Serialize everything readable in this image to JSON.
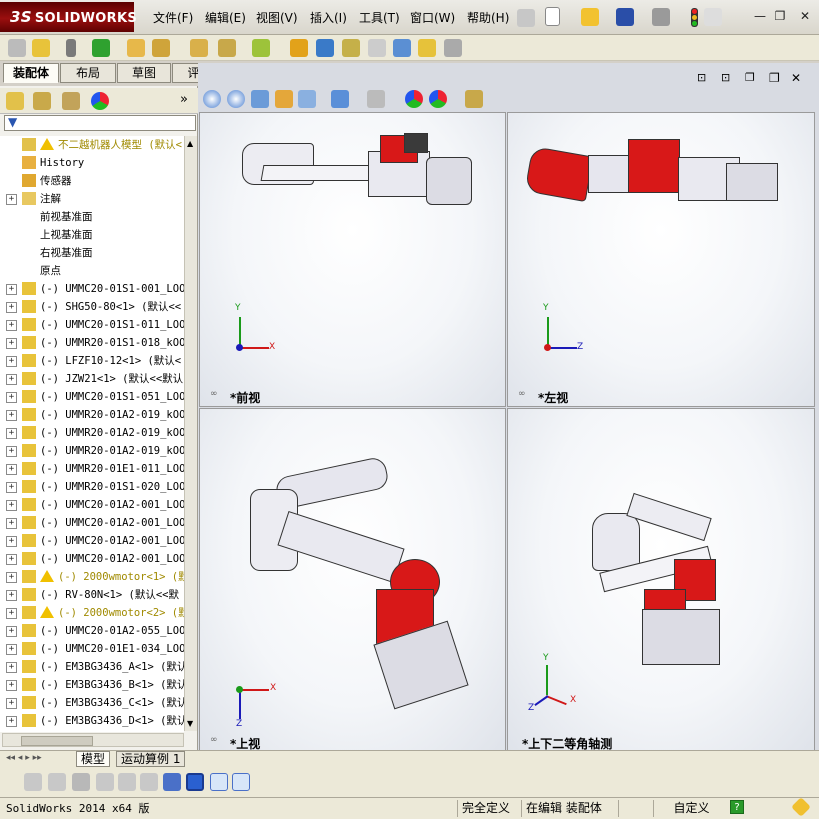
{
  "app": {
    "logo_text": "SOLIDWORKS",
    "logo_prefix": "3S"
  },
  "menu": [
    "文件(F)",
    "编辑(E)",
    "视图(V)",
    "插入(I)",
    "工具(T)",
    "窗口(W)",
    "帮助(H)"
  ],
  "command_tabs": [
    "装配体",
    "布局",
    "草图",
    "评估"
  ],
  "feature_tree": {
    "root_label": "不二越机器人模型  (默认<",
    "fixed_items": [
      {
        "label": "History",
        "icon": "history-icon"
      },
      {
        "label": "传感器",
        "icon": "sensor-icon"
      },
      {
        "label": "注解",
        "icon": "annotation-icon"
      },
      {
        "label": "前视基准面",
        "icon": "plane-icon"
      },
      {
        "label": "上视基准面",
        "icon": "plane-icon"
      },
      {
        "label": "右视基准面",
        "icon": "plane-icon"
      },
      {
        "label": "原点",
        "icon": "origin-icon"
      }
    ],
    "components": [
      {
        "label": "(-) UMMC20-01S1-001_LOO",
        "warn": false
      },
      {
        "label": "(-) SHG50-80<1> (默认<<",
        "warn": false
      },
      {
        "label": "(-) UMMC20-01S1-011_LOO",
        "warn": false
      },
      {
        "label": "(-) UMMR20-01S1-018_kOO",
        "warn": false
      },
      {
        "label": "(-) LFZF10-12<1> (默认<",
        "warn": false
      },
      {
        "label": "(-) JZW21<1> (默认<<默认",
        "warn": false
      },
      {
        "label": "(-) UMMC20-01S1-051_LOO",
        "warn": false
      },
      {
        "label": "(-) UMMR20-01A2-019_kOO",
        "warn": false
      },
      {
        "label": "(-) UMMR20-01A2-019_kOO",
        "warn": false
      },
      {
        "label": "(-) UMMR20-01A2-019_kOO",
        "warn": false
      },
      {
        "label": "(-) UMMR20-01E1-011_LOO",
        "warn": false
      },
      {
        "label": "(-) UMMR20-01S1-020_LOO",
        "warn": false
      },
      {
        "label": "(-) UMMC20-01A2-001_LOO",
        "warn": false
      },
      {
        "label": "(-) UMMC20-01A2-001_LOO",
        "warn": false
      },
      {
        "label": "(-) UMMC20-01A2-001_LOO",
        "warn": false
      },
      {
        "label": "(-) UMMC20-01A2-001_LOO",
        "warn": false
      },
      {
        "label": "(-) 2000wmotor<1> (默",
        "warn": true
      },
      {
        "label": "(-) RV-80N<1> (默认<<默",
        "warn": false
      },
      {
        "label": "(-) 2000wmotor<2> (默",
        "warn": true
      },
      {
        "label": "(-) UMMC20-01A2-055_LOO",
        "warn": false
      },
      {
        "label": "(-) UMMC20-01E1-034_LOO",
        "warn": false
      },
      {
        "label": "(-) EM3BG3436_A<1> (默认",
        "warn": false
      },
      {
        "label": "(-) EM3BG3436_B<1> (默认",
        "warn": false
      },
      {
        "label": "(-) EM3BG3436_C<1> (默认",
        "warn": false
      },
      {
        "label": "(-) EM3BG3436_D<1> (默认",
        "warn": false
      }
    ]
  },
  "viewports": {
    "front": "*前视",
    "left": "*左视",
    "top": "*上视",
    "iso": "*上下二等角轴测"
  },
  "axes": {
    "x": "X",
    "y": "Y",
    "z": "Z"
  },
  "bottom_tabs": [
    "模型",
    "运动算例 1"
  ],
  "status": {
    "version": "SolidWorks 2014 x64 版",
    "definition": "完全定义",
    "editing": "在编辑 装配体",
    "custom": "自定义"
  },
  "colors": {
    "brand_red": "#9b0f0f",
    "robot_red": "#d81818",
    "robot_body": "#e9e9f0"
  }
}
